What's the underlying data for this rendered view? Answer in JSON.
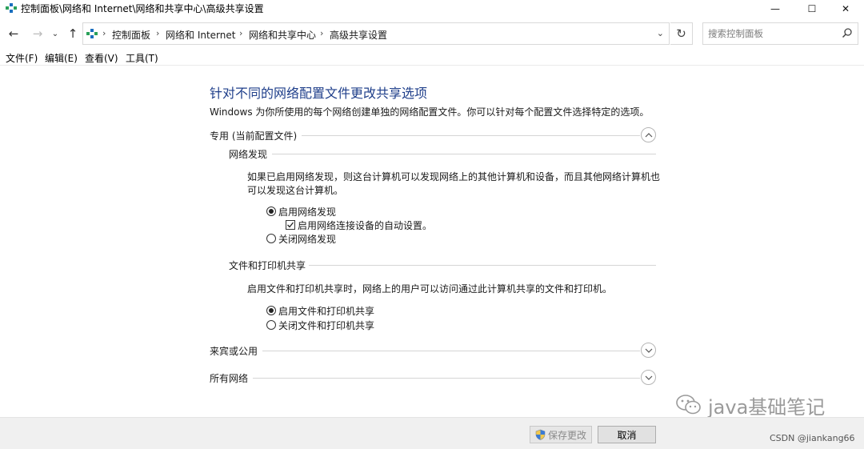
{
  "window": {
    "title": "控制面板\\网络和 Internet\\网络和共享中心\\高级共享设置",
    "controls": {
      "minimize": "—",
      "maximize": "☐",
      "close": "✕"
    }
  },
  "nav": {
    "back_icon": "←",
    "forward_icon": "→",
    "recent_icon": "⌄",
    "up_icon": "↑",
    "breadcrumbs": [
      "控制面板",
      "网络和 Internet",
      "网络和共享中心",
      "高级共享设置"
    ],
    "crumb_separator": "›",
    "address_dropdown": "⌄",
    "refresh_icon": "↻",
    "search_placeholder": "搜索控制面板"
  },
  "menu": {
    "items": [
      "文件(F)",
      "编辑(E)",
      "查看(V)",
      "工具(T)"
    ]
  },
  "main": {
    "heading": "针对不同的网络配置文件更改共享选项",
    "description": "Windows 为你所使用的每个网络创建单独的网络配置文件。你可以针对每个配置文件选择特定的选项。",
    "profiles": [
      {
        "label": "专用 (当前配置文件)",
        "expanded": true
      },
      {
        "label": "来宾或公用",
        "expanded": false
      },
      {
        "label": "所有网络",
        "expanded": false
      }
    ],
    "network_discovery": {
      "title": "网络发现",
      "text_line1": "如果已启用网络发现，则这台计算机可以发现网络上的其他计算机和设备，而且其他网络计算机也",
      "text_line2": "可以发现这台计算机。",
      "opt_on": "启用网络发现",
      "opt_auto": "启用网络连接设备的自动设置。",
      "opt_off": "关闭网络发现",
      "selected": "on",
      "auto_checked": true
    },
    "file_sharing": {
      "title": "文件和打印机共享",
      "text": "启用文件和打印机共享时，网络上的用户可以访问通过此计算机共享的文件和打印机。",
      "opt_on": "启用文件和打印机共享",
      "opt_off": "关闭文件和打印机共享",
      "selected": "on"
    }
  },
  "footer": {
    "save_label": "保存更改",
    "cancel_label": "取消",
    "credit": "CSDN @jiankang66"
  },
  "watermark": {
    "text": "java基础笔记"
  },
  "colors": {
    "heading": "#1e3e8a",
    "footer_bg": "#f0f0f0"
  }
}
